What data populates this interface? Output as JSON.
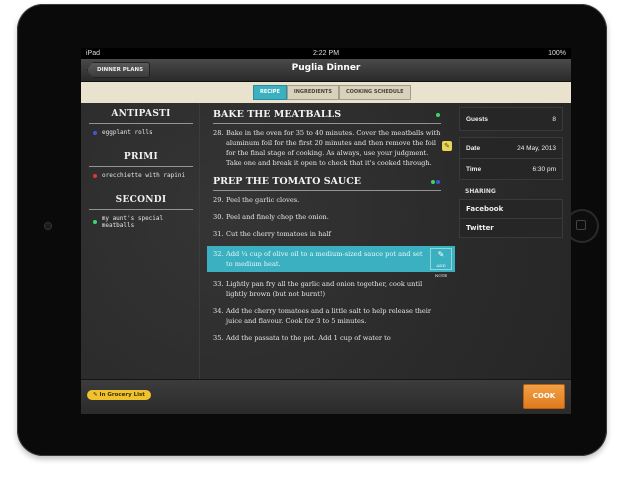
{
  "status": {
    "carrier": "iPad",
    "time": "2:22 PM",
    "battery": "100%"
  },
  "nav": {
    "back_label": "DINNER PLANS",
    "title": "Puglia Dinner"
  },
  "tabs": [
    {
      "label": "RECIPE",
      "active": true
    },
    {
      "label": "INGREDIENTS",
      "active": false
    },
    {
      "label": "COOKING SCHEDULE",
      "active": false
    }
  ],
  "menu": {
    "sections": [
      {
        "title": "ANTIPASTI",
        "items": [
          {
            "label": "eggplant rolls",
            "dot": "#3b5bd6"
          }
        ]
      },
      {
        "title": "PRIMI",
        "items": [
          {
            "label": "orecchiette with rapini",
            "dot": "#d63b3b"
          }
        ]
      },
      {
        "title": "SECONDI",
        "items": [
          {
            "label": "my aunt's special meatballs",
            "dot": "#3bd66a"
          }
        ]
      }
    ]
  },
  "recipe": {
    "bake_heading": "BAKE THE MEATBALLS",
    "step28_num": "28.",
    "step28": "Bake in the oven for 35 to 40 minutes. Cover the meatballs with aluminum foil for the first 20 minutes and then remove the foil for the final stage of cooking. As always, use your judgment. Take one and break it open to check that it's cooked through.",
    "prep_heading": "PREP THE TOMATO SAUCE",
    "steps": [
      {
        "num": "29.",
        "text": "Peel the garlic cloves."
      },
      {
        "num": "30.",
        "text": "Peel and finely chop the onion."
      },
      {
        "num": "31.",
        "text": "Cut the cherry tomatoes in half"
      },
      {
        "num": "32.",
        "text": "Add ¼ cup of olive oil to a medium-sized sauce pot and set to medium heat."
      },
      {
        "num": "33.",
        "text": "Lightly pan fry all the garlic and onion together, cook until lightly brown (but not burnt!)"
      },
      {
        "num": "34.",
        "text": "Add the cherry tomatoes and a little salt to help release their juice and flavour. Cook for 3 to 5 minutes."
      },
      {
        "num": "35.",
        "text": "Add the passata to the pot. Add 1 cup of water to"
      }
    ],
    "add_note_label": "ADD NOTE"
  },
  "details": {
    "guests_label": "Guests",
    "guests_value": "8",
    "date_label": "Date",
    "date_value": "24 May, 2013",
    "time_label": "Time",
    "time_value": "6:30 pm",
    "sharing_label": "SHARING",
    "facebook": "Facebook",
    "twitter": "Twitter"
  },
  "bottom": {
    "grocery_label": "In Grocery List",
    "cook_label": "COOK THIS!"
  },
  "colors": {
    "accent": "#3bb0c0",
    "cook": "#e88a2e",
    "grocery": "#f0c22e"
  }
}
